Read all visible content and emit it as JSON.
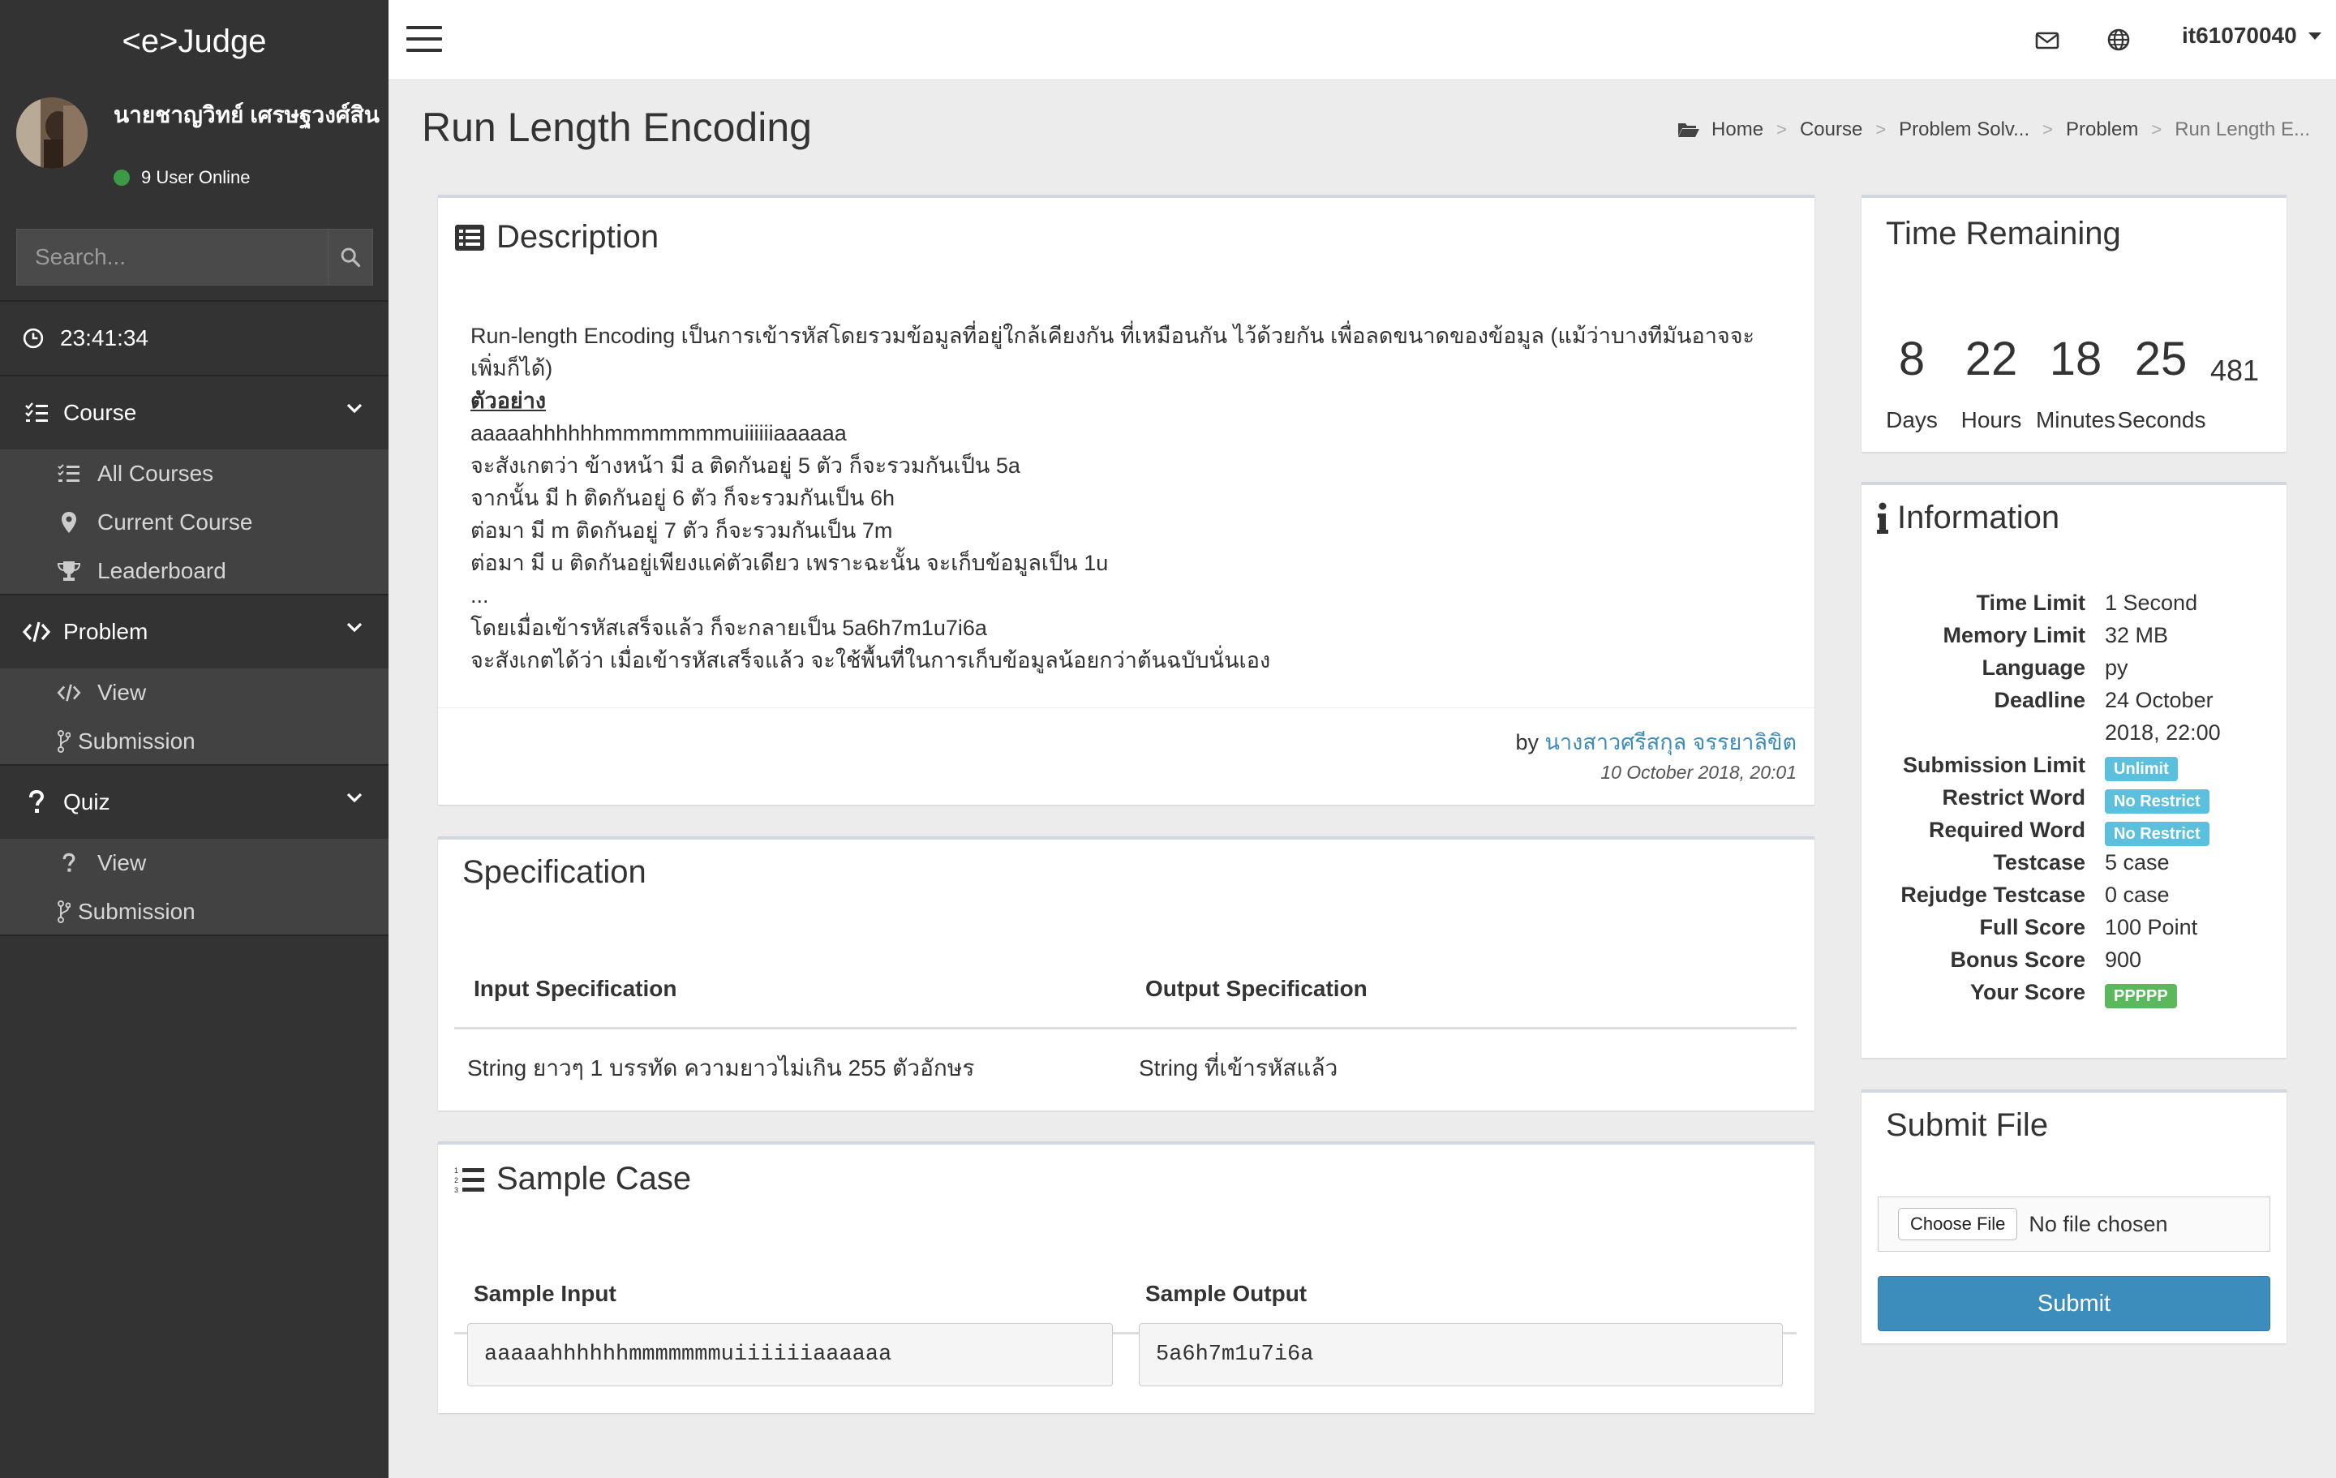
{
  "sidebar": {
    "logo": "<e>Judge",
    "user": {
      "name": "นายชาญวิทย์ เศรษฐวงศ์สิน",
      "online": "9 User Online"
    },
    "search_placeholder": "Search...",
    "clock": "23:41:34",
    "menus": [
      {
        "label": "Course",
        "items": [
          "All Courses",
          "Current Course",
          "Leaderboard"
        ]
      },
      {
        "label": "Problem",
        "items": [
          "View",
          "Submission"
        ]
      },
      {
        "label": "Quiz",
        "items": [
          "View",
          "Submission"
        ]
      }
    ]
  },
  "topbar": {
    "username": "it61070040"
  },
  "page": {
    "title": "Run Length Encoding",
    "breadcrumb": [
      "Home",
      "Course",
      "Problem Solv...",
      "Problem",
      "Run Length E..."
    ]
  },
  "description": {
    "title": "Description",
    "line1": "Run-length Encoding เป็นการเข้ารหัสโดยรวมข้อมูลที่อยู่ใกล้เคียงกัน ที่เหมือนกัน ไว้ด้วยกัน เพื่อลดขนาดของข้อมูล (แม้ว่าบางทีมันอาจจะเพิ่มก็ได้)",
    "example_label": "ตัวอย่าง",
    "lines": [
      "aaaaahhhhhhmmmmmmmuiiiiiiaaaaaa",
      "จะสังเกตว่า ข้างหน้า มี a ติดกันอยู่ 5 ตัว ก็จะรวมกันเป็น 5a",
      "จากนั้น มี h ติดกันอยู่ 6 ตัว ก็จะรวมกันเป็น 6h",
      "ต่อมา มี m ติดกันอยู่ 7 ตัว ก็จะรวมกันเป็น 7m",
      "ต่อมา มี u ติดกันอยู่เพียงแค่ตัวเดียว เพราะฉะนั้น จะเก็บข้อมูลเป็น 1u",
      "...",
      "โดยเมื่อเข้ารหัสเสร็จแล้ว ก็จะกลายเป็น 5a6h7m1u7i6a",
      "จะสังเกตได้ว่า เมื่อเข้ารหัสเสร็จแล้ว จะใช้พื้นที่ในการเก็บข้อมูลน้อยกว่าต้นฉบับนั่นเอง"
    ],
    "by_prefix": "by",
    "author": "นางสาวศรีสกุล จรรยาลิขิต",
    "date": "10 October 2018, 20:01"
  },
  "specification": {
    "title": "Specification",
    "input_header": "Input Specification",
    "output_header": "Output Specification",
    "input": "String ยาวๆ 1 บรรทัด ความยาวไม่เกิน 255 ตัวอักษร",
    "output": "String ที่เข้ารหัสแล้ว"
  },
  "sample": {
    "title": "Sample Case",
    "input_header": "Sample Input",
    "output_header": "Sample Output",
    "input": "aaaaahhhhhhmmmmmmmuiiiiiiaaaaaa",
    "output": "5a6h7m1u7i6a"
  },
  "time_remaining": {
    "title": "Time Remaining",
    "days": "8",
    "hours": "22",
    "minutes": "18",
    "seconds": "25",
    "ms": "481",
    "labels": [
      "Days",
      "Hours",
      "Minutes",
      "Seconds"
    ]
  },
  "information": {
    "title": "Information",
    "time_limit": {
      "k": "Time Limit",
      "v": "1 Second"
    },
    "memory_limit": {
      "k": "Memory Limit",
      "v": "32 MB"
    },
    "language": {
      "k": "Language",
      "v": "py"
    },
    "deadline": {
      "k": "Deadline",
      "v1": "24 October",
      "v2": "2018, 22:00"
    },
    "submission_limit": {
      "k": "Submission Limit",
      "v": "Unlimit"
    },
    "restrict_word": {
      "k": "Restrict Word",
      "v": "No Restrict"
    },
    "required_word": {
      "k": "Required Word",
      "v": "No Restrict"
    },
    "testcase": {
      "k": "Testcase",
      "v": "5 case"
    },
    "rejudge_testcase": {
      "k": "Rejudge Testcase",
      "v": "0 case"
    },
    "full_score": {
      "k": "Full Score",
      "v": "100 Point"
    },
    "bonus_score": {
      "k": "Bonus Score",
      "v": "900"
    },
    "your_score": {
      "k": "Your Score",
      "v": "PPPPP"
    }
  },
  "submit": {
    "title": "Submit File",
    "choose_label": "Choose File",
    "no_file": "No file chosen",
    "submit_label": "Submit"
  },
  "colors": {
    "sidebar": "#333333",
    "accent": "#3c8dbc",
    "badge_info": "#5bc0de",
    "badge_success": "#5cb85c",
    "online": "#3c9a44"
  }
}
